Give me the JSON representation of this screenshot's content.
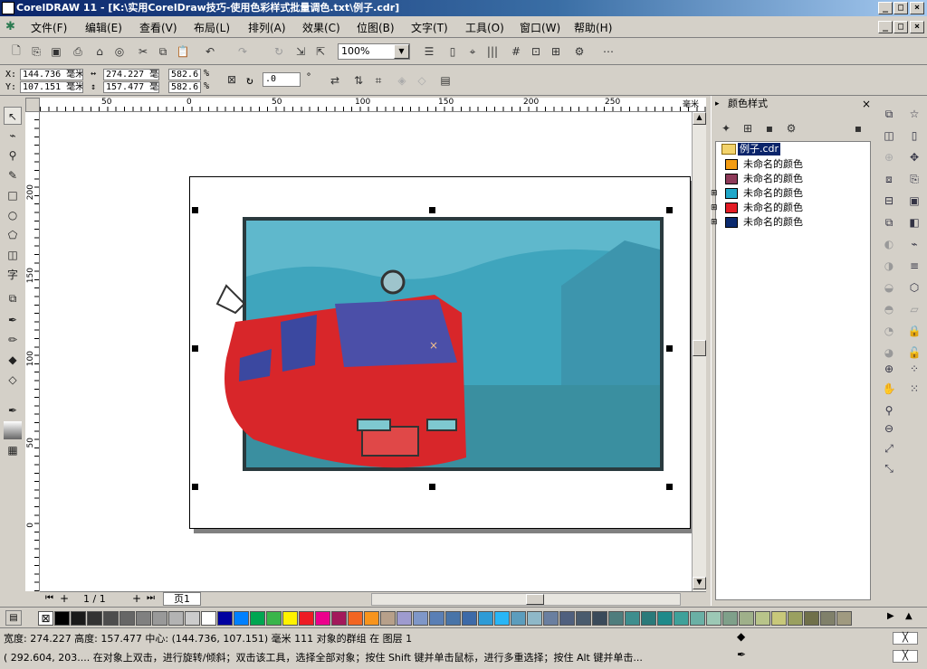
{
  "window": {
    "title": "CorelDRAW 11 - [K:\\实用CorelDraw技巧-使用色彩样式批量调色.txt\\例子.cdr]"
  },
  "menu": [
    "文件(F)",
    "编辑(E)",
    "查看(V)",
    "布局(L)",
    "排列(A)",
    "效果(C)",
    "位图(B)",
    "文字(T)",
    "工具(O)",
    "窗口(W)",
    "帮助(H)"
  ],
  "toolbar": {
    "zoom": "100%"
  },
  "propbar": {
    "x_label": "X:",
    "x_value": "144.736 毫米",
    "y_label": "Y:",
    "y_value": "107.151 毫米",
    "w_value": "274.227 毫",
    "h_value": "157.477 毫",
    "sx_value": "582.6",
    "sy_value": "582.6",
    "pct": "%",
    "angle_value": ".0",
    "deg": "°"
  },
  "ruler_h_ticks": [
    "50",
    "0",
    "50",
    "100",
    "150",
    "200",
    "250"
  ],
  "ruler_h_unit": "毫米",
  "ruler_v_ticks": [
    "200",
    "150",
    "100",
    "50",
    "0"
  ],
  "page_nav": {
    "count": "1 / 1",
    "page_tab": "页1"
  },
  "docker": {
    "title": "颜色样式",
    "root": "例子.cdr",
    "items": [
      {
        "label": "未命名的颜色",
        "color": "#f39c12",
        "expandable": false
      },
      {
        "label": "未命名的颜色",
        "color": "#8e3a59",
        "expandable": false
      },
      {
        "label": "未命名的颜色",
        "color": "#1fa7c9",
        "expandable": true
      },
      {
        "label": "未命名的颜色",
        "color": "#e31c25",
        "expandable": true
      },
      {
        "label": "未命名的颜色",
        "color": "#0b2a6f",
        "expandable": true
      }
    ]
  },
  "palette": [
    "#000000",
    "#1a1a1a",
    "#333333",
    "#4d4d4d",
    "#666666",
    "#808080",
    "#999999",
    "#b3b3b3",
    "#cccccc",
    "#ffffff",
    "#0000a0",
    "#0080ff",
    "#00a651",
    "#39b54a",
    "#fff200",
    "#ed1c24",
    "#ec008c",
    "#a3195b",
    "#f26522",
    "#f7941d",
    "#b7a08a",
    "#9e9bcf",
    "#7f97c8",
    "#5a7fb5",
    "#4874a8",
    "#3d6aa8",
    "#2e9bd6",
    "#29b6f6",
    "#5c9dbd",
    "#8fb8c8",
    "#6a7fa0",
    "#50607e",
    "#4a5b6d",
    "#3a4a5a",
    "#4f7d7d",
    "#3e8e8e",
    "#2a7a7a",
    "#1f8a8a",
    "#3fa19a",
    "#6ab0a5",
    "#9cc8b5",
    "#7fa08a",
    "#9fb08a",
    "#b8c48a",
    "#c8c87a",
    "#9aa060",
    "#70704a",
    "#80806a",
    "#a09a80"
  ],
  "status": {
    "line1": "宽度: 274.227  高度: 157.477  中心: (144.736, 107.151)  毫米        111 对象的群组 在 图层 1",
    "line2": "( 292.604, 203....  在对象上双击，进行旋转/倾斜；双击该工具，选择全部对象；按住 Shift 键并单击鼠标，进行多重选择；按住 Alt 键并单击..."
  }
}
